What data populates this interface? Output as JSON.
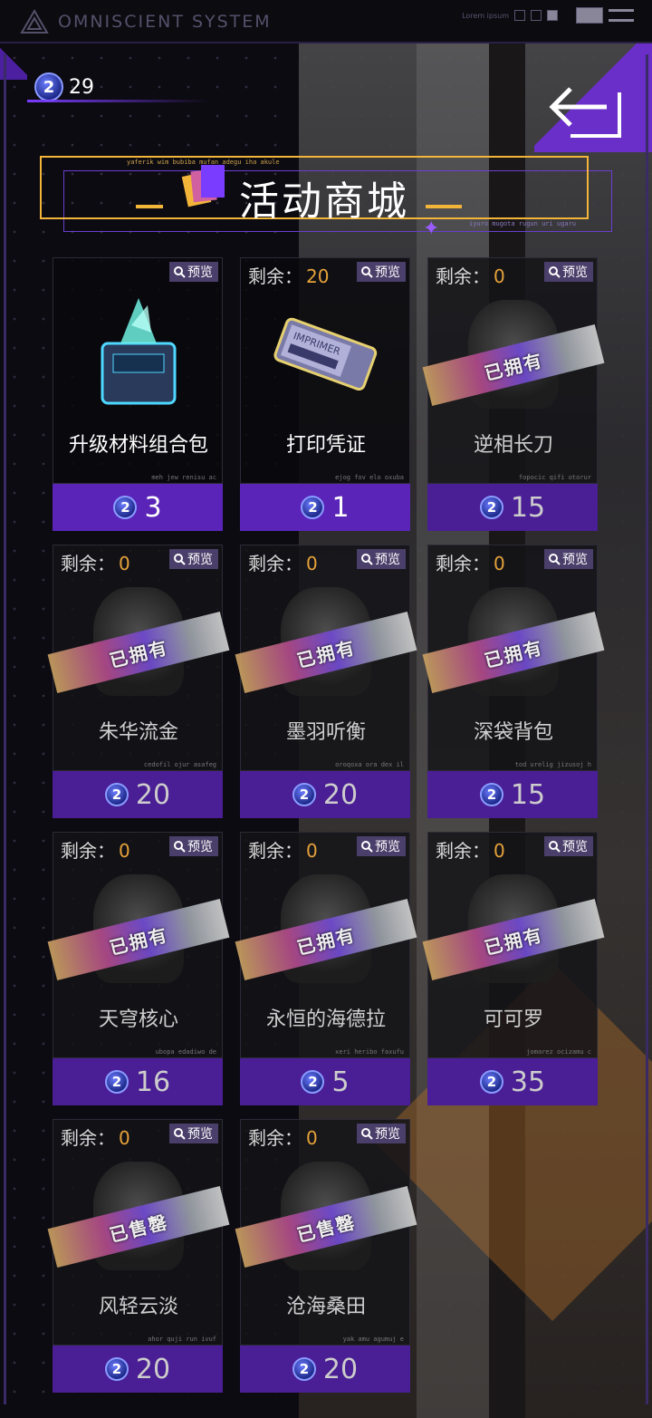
{
  "topbar": {
    "brand": "OMNISCIENT SYSTEM",
    "deco_text": "Lorem ipsum"
  },
  "currency": {
    "icon": "event-coin-icon",
    "glyph": "2",
    "amount": "29"
  },
  "title": {
    "text": "活动商城",
    "small_top": "yaferik wim bubiba mufan adegu iha akule",
    "small_bottom": "iyuro mugota rugun uri ugaru"
  },
  "labels": {
    "preview": "预览",
    "remain": "剩余：",
    "coin_glyph": "2"
  },
  "items": [
    {
      "name": "升级材料组合包",
      "price": "3",
      "remain": "",
      "status": "",
      "micro": "meh jew renisu ac",
      "icon": "material-box-icon"
    },
    {
      "name": "打印凭证",
      "price": "1",
      "remain": "20",
      "status": "",
      "micro": "ejog fov elo oxuba",
      "icon": "print-ticket-icon",
      "ticket_text": "IMPRIMER"
    },
    {
      "name": "逆相长刀",
      "price": "15",
      "remain": "0",
      "status": "已拥有",
      "micro": "fopocic qifi otorur",
      "icon": "blade-icon"
    },
    {
      "name": "朱华流金",
      "price": "20",
      "remain": "0",
      "status": "已拥有",
      "micro": "cedofil ojur asafeg",
      "icon": "outfit-icon"
    },
    {
      "name": "墨羽听衡",
      "price": "20",
      "remain": "0",
      "status": "已拥有",
      "micro": "oroqoxa ora dex il",
      "icon": "outfit-icon"
    },
    {
      "name": "深袋背包",
      "price": "15",
      "remain": "0",
      "status": "已拥有",
      "micro": "tod urelig jizusoj h",
      "icon": "backpack-icon"
    },
    {
      "name": "天穹核心",
      "price": "16",
      "remain": "0",
      "status": "已拥有",
      "micro": "ubopa edadiwo de",
      "icon": "core-icon"
    },
    {
      "name": "永恒的海德拉",
      "price": "5",
      "remain": "0",
      "status": "已拥有",
      "micro": "xeri heribo faxufu",
      "icon": "hydra-icon"
    },
    {
      "name": "可可罗",
      "price": "35",
      "remain": "0",
      "status": "已拥有",
      "micro": "jomarez ocizamu c",
      "icon": "robot-icon"
    },
    {
      "name": "风轻云淡",
      "price": "20",
      "remain": "0",
      "status": "已售罄",
      "micro": "ahor quji run ivuf",
      "icon": "avatar-icon"
    },
    {
      "name": "沧海桑田",
      "price": "20",
      "remain": "0",
      "status": "已售罄",
      "micro": "yak amu agumuj e",
      "icon": "avatar-icon"
    }
  ],
  "colors": {
    "accent": "#5a24b8",
    "gold": "#f2b53a",
    "remain_number": "#e6a23a"
  }
}
